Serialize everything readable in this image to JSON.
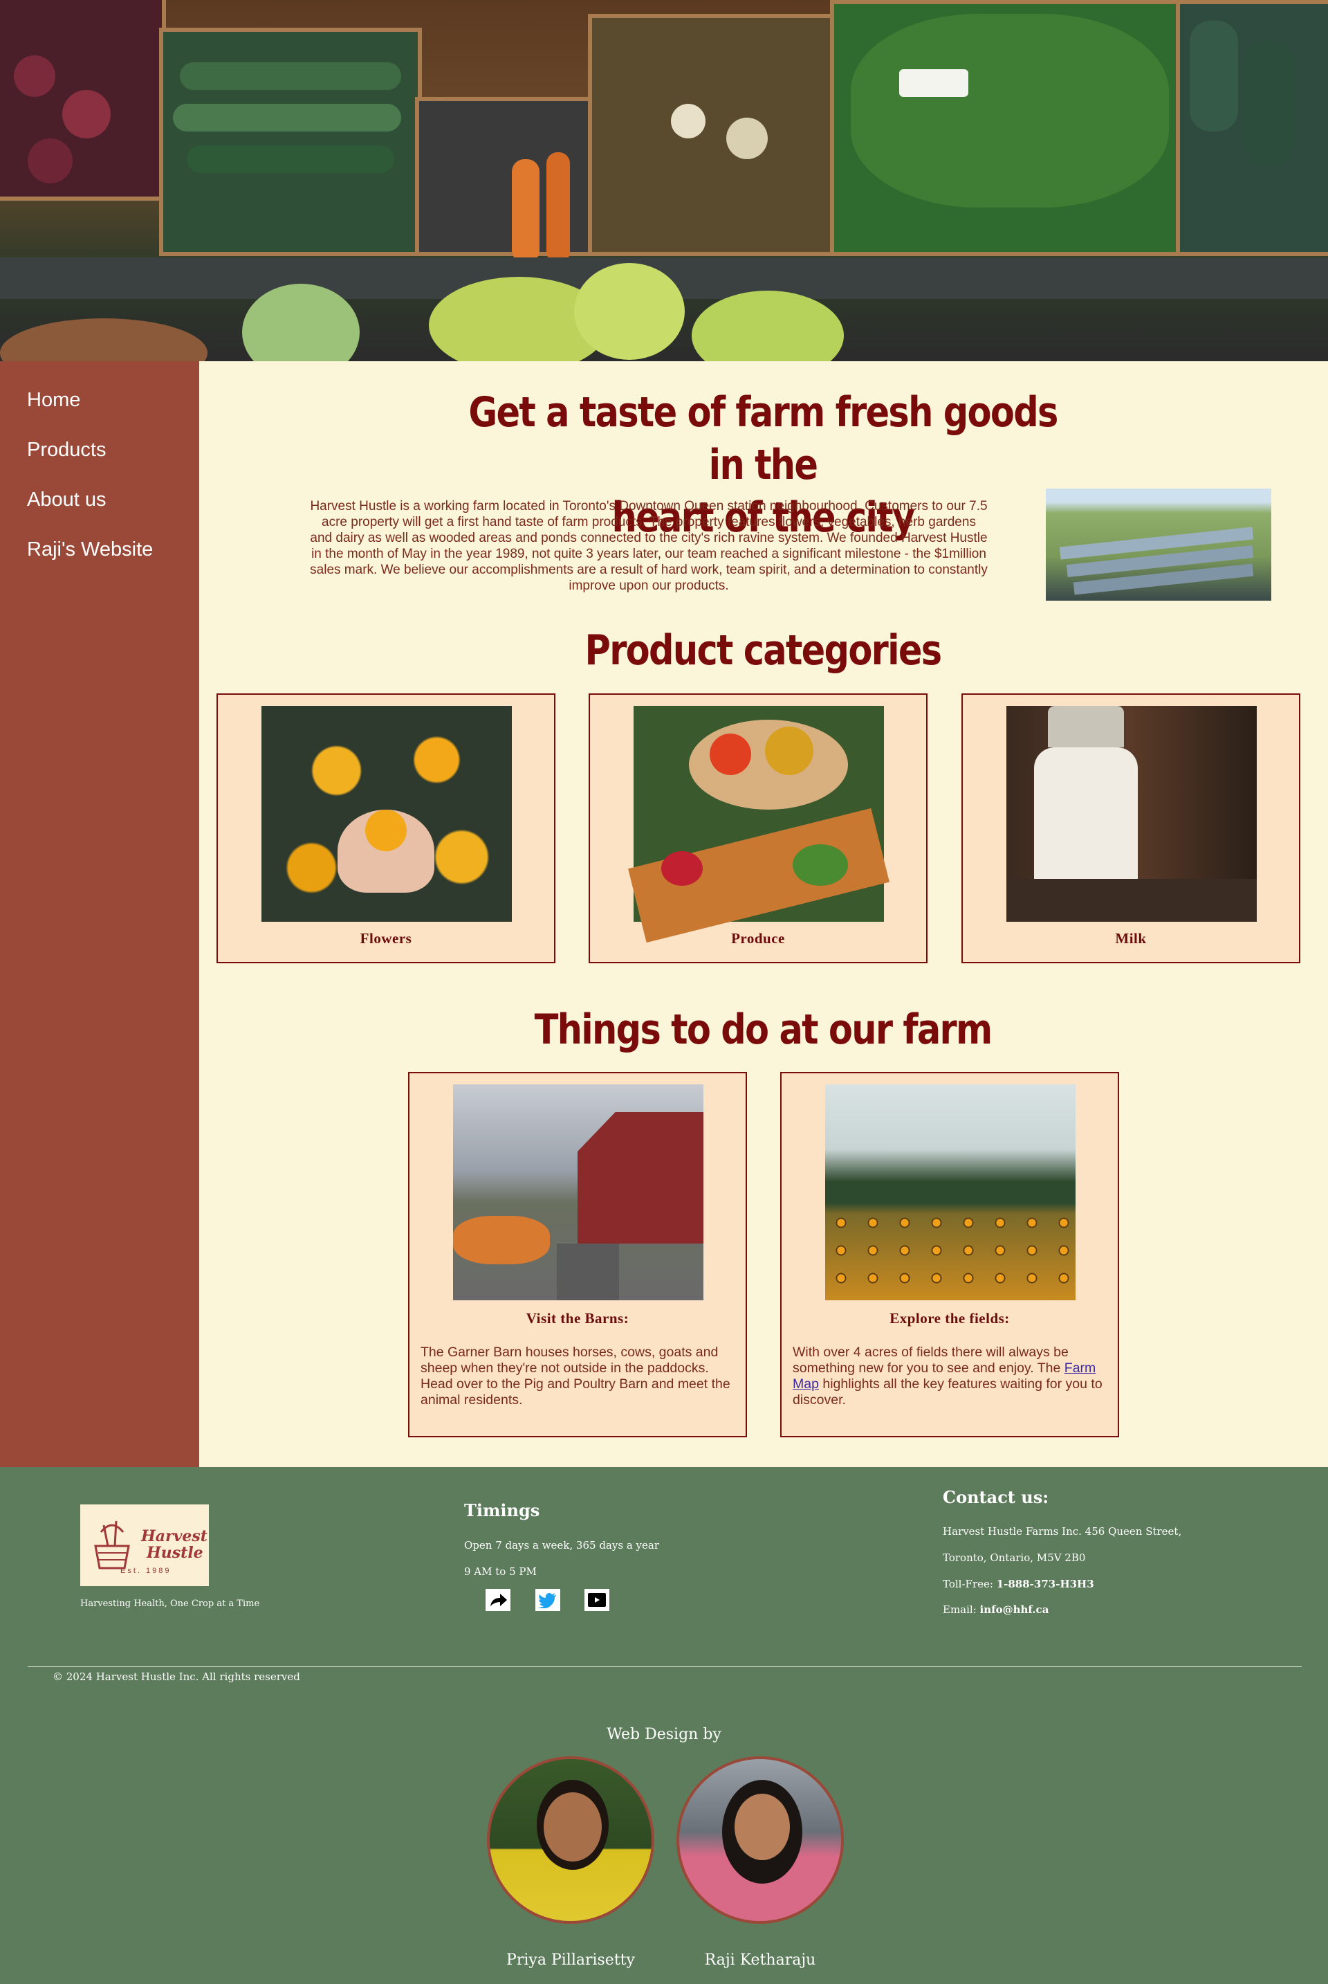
{
  "nav": {
    "items": [
      "Home",
      "Products",
      "About us",
      "Raji's Website"
    ]
  },
  "hero": {
    "title_line1": "Get a taste of farm fresh goods in the",
    "title_line2": "heart of the city",
    "intro": "Harvest Hustle is a working farm located in Toronto's Downtown Queen station neighbourhood. Customers to our 7.5 acre property will get a first hand taste of farm products. The property features flowers, vegetables, herb gardens and dairy as well as wooded areas and ponds connected to the city's rich ravine system. We founded Harvest Hustle in the month of May in the year 1989, not quite 3 years later, our team reached a significant milestone - the $1million sales mark. We believe our accomplishments are a result of hard work, team spirit, and a determination to constantly improve upon our products."
  },
  "products": {
    "heading": "Product categories",
    "items": [
      {
        "label": "Flowers"
      },
      {
        "label": "Produce"
      },
      {
        "label": "Milk"
      }
    ]
  },
  "activities": {
    "heading": "Things to do at our farm",
    "items": [
      {
        "label": "Visit the Barns:",
        "text": "The Garner Barn houses horses, cows, goats and sheep when they're not outside in the paddocks. Head over to the Pig and Poultry Barn and meet the animal residents."
      },
      {
        "label": "Explore the fields:",
        "text_before": "With over 4 acres of fields there will always be something new for you to see and enjoy. The ",
        "link": "Farm Map",
        "text_after": " highlights all the key features waiting for you to discover."
      }
    ]
  },
  "footer": {
    "logo_line1": "Harvest",
    "logo_line2": "Hustle",
    "logo_est": "Est. 1989",
    "tagline": "Harvesting Health, One Crop at a Time",
    "timings_heading": "Timings",
    "timings_line1": "Open 7 days a week, 365 days a year",
    "timings_line2": "9 AM to 5 PM",
    "social_icons": [
      "share-icon",
      "twitter-icon",
      "youtube-icon"
    ],
    "contact_heading": "Contact us:",
    "address_line1": "Harvest Hustle Farms Inc. 456 Queen Street,",
    "address_line2": "Toronto, Ontario, M5V 2B0",
    "tollfree_label": "Toll-Free: ",
    "tollfree_value": "1-888-373-H3H3",
    "email_label": "Email: ",
    "email_value": "info@hhf.ca",
    "copyright": "© 2024 Harvest Hustle Inc. All rights reserved",
    "webdesign_heading": "Web Design by",
    "designers": [
      "Priya Pillarisetty",
      "Raji Ketharaju"
    ]
  },
  "colors": {
    "sidebar": "#9a4838",
    "main_bg": "#fbf5d9",
    "heading": "#7a0b0b",
    "card_bg": "#fde3c6",
    "footer_bg": "#5d7c5c"
  }
}
